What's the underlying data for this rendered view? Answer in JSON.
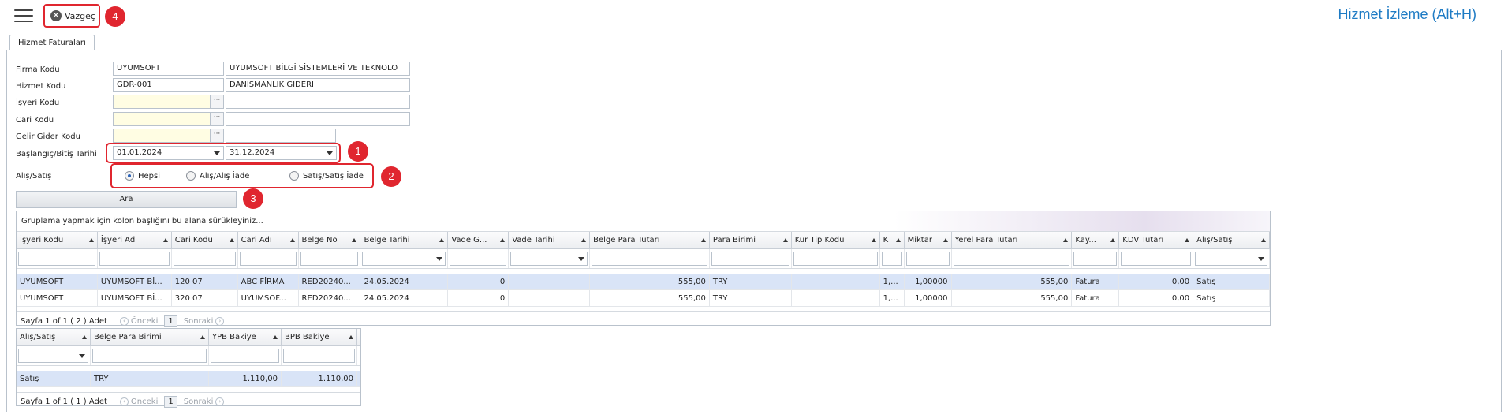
{
  "toolbar": {
    "cancel_label": "Vazgeç",
    "menu_icon": "hamburger-menu-icon"
  },
  "page_title": "Hizmet İzleme (Alt+H)",
  "tab": {
    "label": "Hizmet Faturaları"
  },
  "badges": [
    "1",
    "2",
    "3",
    "4"
  ],
  "form": {
    "firma_kodu": {
      "label": "Firma Kodu",
      "code": "UYUMSOFT",
      "name": "UYUMSOFT BİLGİ SİSTEMLERİ VE TEKNOLO"
    },
    "hizmet_kodu": {
      "label": "Hizmet Kodu",
      "code": "GDR-001",
      "name": "DANIŞMANLIK GİDERİ"
    },
    "isyeri_kodu": {
      "label": "İşyeri Kodu",
      "code": "",
      "name": ""
    },
    "cari_kodu": {
      "label": "Cari Kodu",
      "code": "",
      "name": ""
    },
    "gelir_gider_kodu": {
      "label": "Gelir Gider Kodu",
      "code": "",
      "name": ""
    },
    "tarih": {
      "label": "Başlangıç/Bitiş Tarihi",
      "start": "01.01.2024",
      "end": "31.12.2024"
    },
    "alis_satis": {
      "label": "Alış/Satış",
      "options": [
        "Hepsi",
        "Alış/Alış İade",
        "Satış/Satış İade"
      ],
      "selected": "Hepsi"
    },
    "search_button": "Ara"
  },
  "main_grid": {
    "group_hint": "Gruplama yapmak için kolon başlığını bu alana sürükleyiniz...",
    "columns": [
      "İşyeri Kodu",
      "İşyeri Adı",
      "Cari Kodu",
      "Cari Adı",
      "Belge No",
      "Belge Tarihi",
      "Vade G...",
      "Vade Tarihi",
      "Belge Para Tutarı",
      "Para Birimi",
      "Kur Tip Kodu",
      "K",
      "Miktar",
      "Yerel Para Tutarı",
      "Kay...",
      "KDV Tutarı",
      "Alış/Satış"
    ],
    "rows": [
      [
        "UYUMSOFT",
        "UYUMSOFT Bİ...",
        "120 07",
        "ABC FİRMA",
        "RED20240...",
        "24.05.2024",
        "0",
        "",
        "555,00",
        "TRY",
        "",
        "1,...",
        "1,00000",
        "555,00",
        "Fatura",
        "0,00",
        "Satış"
      ],
      [
        "UYUMSOFT",
        "UYUMSOFT Bİ...",
        "320 07",
        "UYUMSOF...",
        "RED20240...",
        "24.05.2024",
        "0",
        "",
        "555,00",
        "TRY",
        "",
        "1,...",
        "1,00000",
        "555,00",
        "Fatura",
        "0,00",
        "Satış"
      ]
    ],
    "pager": {
      "summary": "Sayfa 1 of 1 ( 2 ) Adet",
      "prev": "Önceki",
      "page": "1",
      "next": "Sonraki"
    }
  },
  "summary_grid": {
    "columns": [
      "Alış/Satış",
      "Belge Para Birimi",
      "YPB Bakiye",
      "BPB Bakiye"
    ],
    "rows": [
      [
        "Satış",
        "TRY",
        "1.110,00",
        "1.110,00"
      ]
    ],
    "pager": {
      "summary": "Sayfa 1 of 1 ( 1 ) Adet",
      "prev": "Önceki",
      "page": "1",
      "next": "Sonraki"
    }
  },
  "colors": {
    "accent": "#1e7bc4",
    "highlight": "#e0262f",
    "selected_row": "#d9e4f7",
    "required_field": "#fffde3"
  }
}
